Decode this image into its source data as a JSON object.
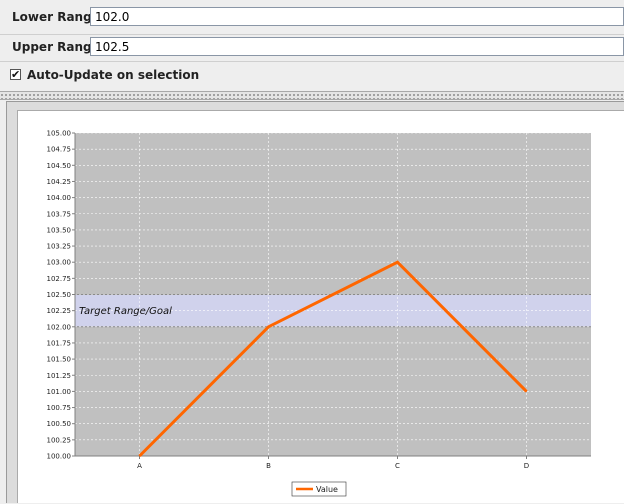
{
  "form": {
    "lower_range": {
      "label": "Lower Range",
      "value": "102.0"
    },
    "upper_range": {
      "label": "Upper Range",
      "value": "102.5"
    },
    "auto_update": {
      "label": "Auto-Update on selection",
      "checked": true,
      "check_glyph": "✔"
    }
  },
  "chart_data": {
    "type": "line",
    "categories": [
      "A",
      "B",
      "C",
      "D"
    ],
    "series": [
      {
        "name": "Value",
        "values": [
          100.0,
          102.0,
          103.0,
          101.0
        ],
        "color": "#ff6600"
      }
    ],
    "ylim": [
      100.0,
      105.0
    ],
    "yticks": [
      "100.00",
      "100.25",
      "100.50",
      "100.75",
      "101.00",
      "101.25",
      "101.50",
      "101.75",
      "102.00",
      "102.25",
      "102.50",
      "102.75",
      "103.00",
      "103.25",
      "103.50",
      "103.75",
      "104.00",
      "104.25",
      "104.50",
      "104.75",
      "105.00"
    ],
    "interval_marker": {
      "label": "Target Range/Goal",
      "start": 102.0,
      "end": 102.5,
      "color": "#d0d2ec"
    },
    "plot_background": "#c0c0c0",
    "gridlines": true,
    "legend_position": "bottom"
  }
}
